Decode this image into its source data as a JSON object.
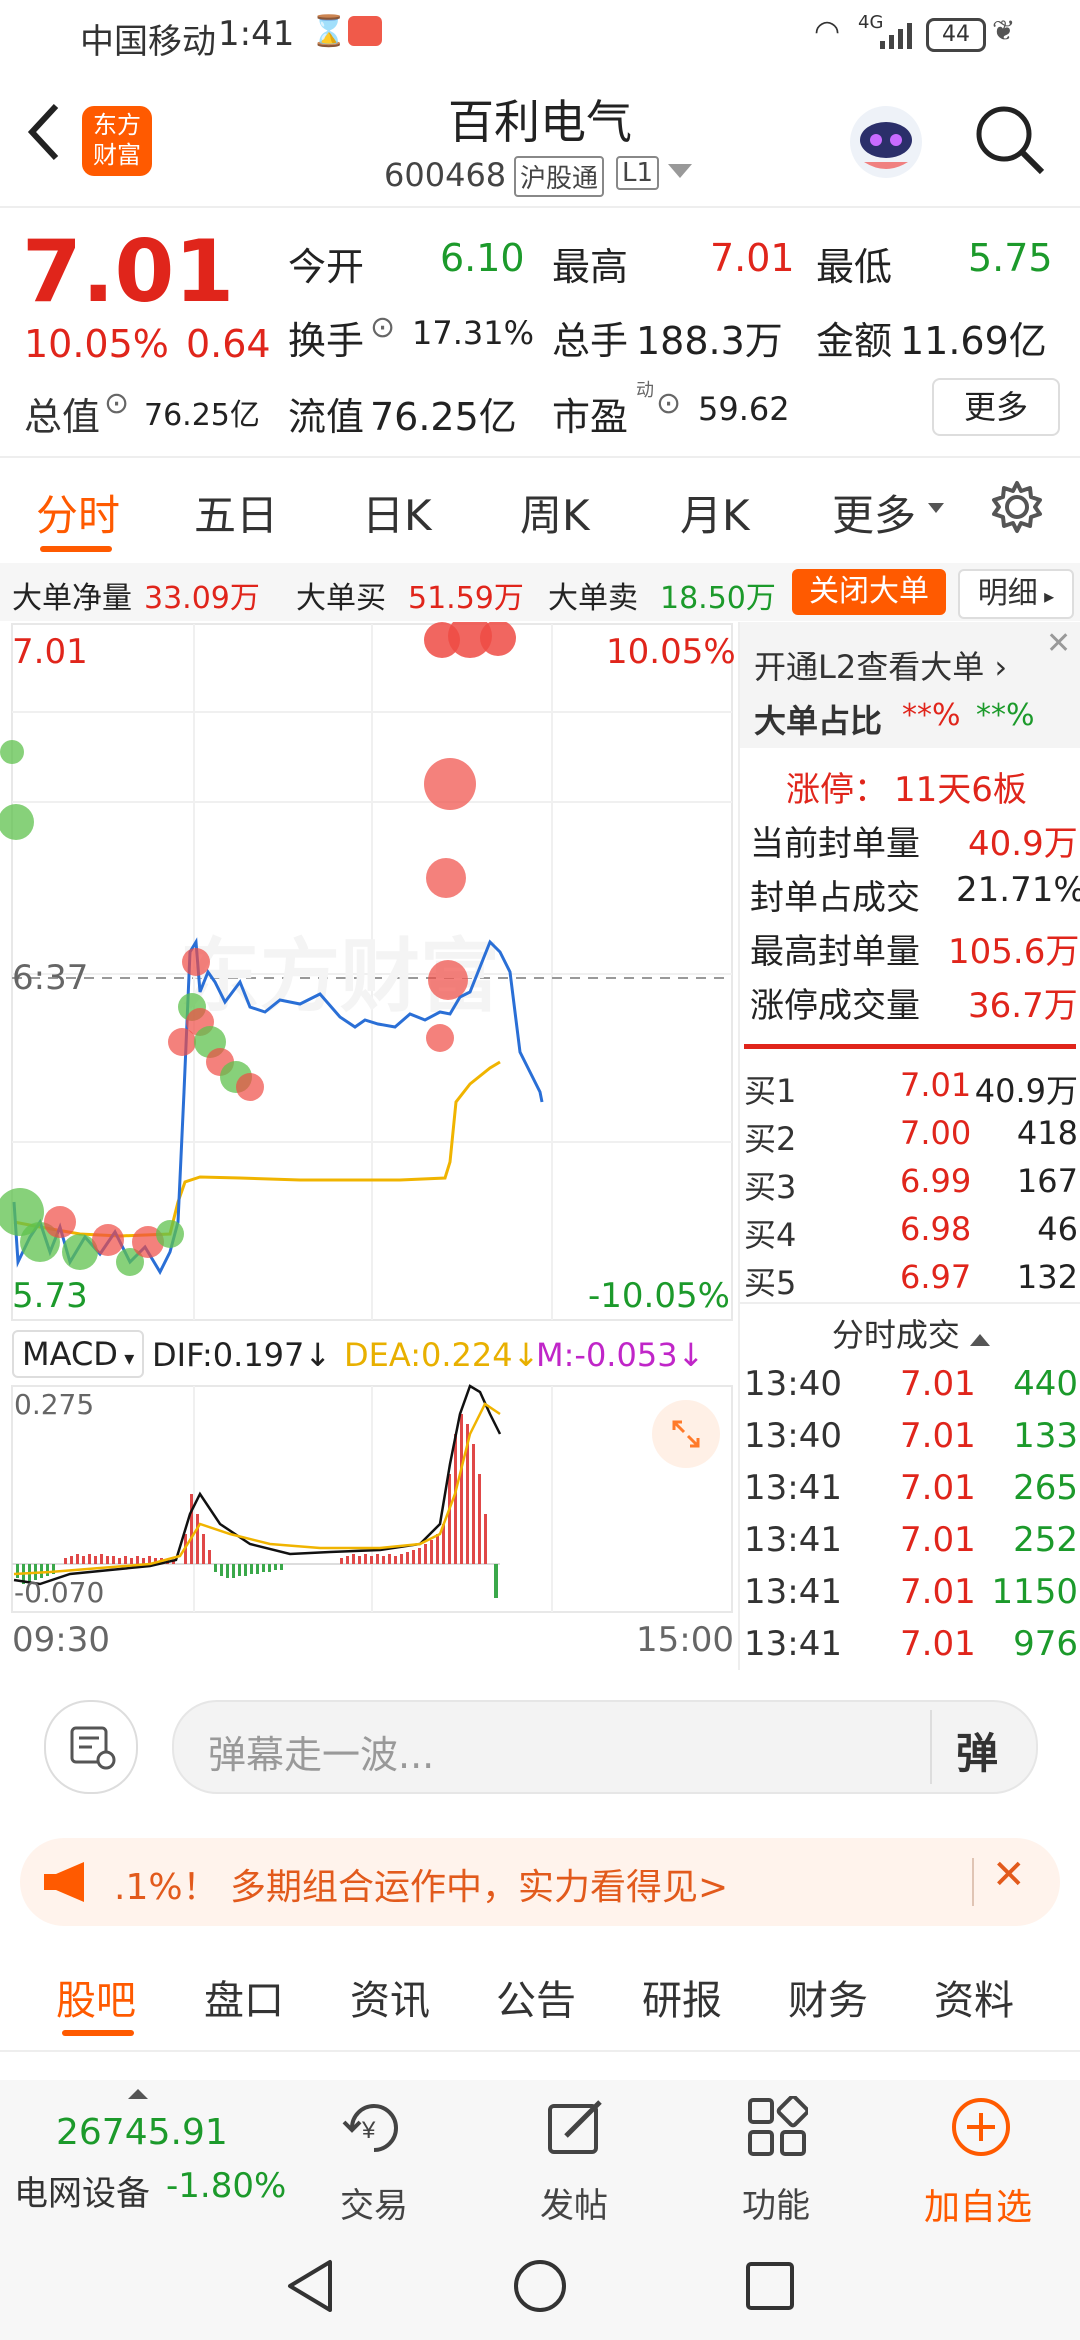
{
  "status_bar": {
    "carrier": "中国移动",
    "time": "1:41",
    "network": "4G",
    "battery": "44"
  },
  "header": {
    "brand_line1": "东方",
    "brand_line2": "财富",
    "stock_name": "百利电气",
    "stock_code": "600468",
    "connect_tag": "沪股通",
    "level_tag": "L1"
  },
  "quote": {
    "price": "7.01",
    "change_pct": "10.05%",
    "change_abs": "0.64",
    "open_label": "今开",
    "open_value": "6.10",
    "high_label": "最高",
    "high_value": "7.01",
    "low_label": "最低",
    "low_value": "5.75",
    "turnover_label": "换手",
    "turnover_value": "17.31%",
    "volume_label": "总手",
    "volume_value": "188.3万",
    "amount_label": "金额",
    "amount_value": "11.69亿",
    "mcap_label": "总值",
    "mcap_value": "76.25亿",
    "float_label": "流值",
    "float_value": "76.25亿",
    "pe_label": "市盈",
    "pe_sup": "动",
    "pe_value": "59.62",
    "more_button": "更多"
  },
  "period_tabs": [
    "分时",
    "五日",
    "日K",
    "周K",
    "月K",
    "更多"
  ],
  "big_order": {
    "net_label": "大单净量",
    "net_value": "33.09万",
    "buy_label": "大单买",
    "buy_value": "51.59万",
    "sell_label": "大单卖",
    "sell_value": "18.50万",
    "close_button": "关闭大单",
    "detail_button": "明细"
  },
  "chart_labels": {
    "top_price": "7.01",
    "top_pct": "10.05%",
    "mid_price": "6:37",
    "bottom_price": "5.73",
    "bottom_pct": "-10.05%",
    "time_start": "09:30",
    "time_end": "15:00",
    "watermark": "东方财富"
  },
  "macd": {
    "name": "MACD",
    "dif": "DIF:0.197↓",
    "dea": "DEA:0.224↓",
    "m": "M:-0.053↓",
    "top_value": "0.275",
    "bottom_value": "-0.070"
  },
  "l2_panel": {
    "title": "开通L2查看大单 ›",
    "ratio_label": "大单占比",
    "ratio_red": "**%",
    "ratio_green": "**%",
    "limit_label": "涨停：",
    "limit_value": "11天6板",
    "seal_label": "当前封单量",
    "seal_value": "40.9万",
    "seal_ratio_label": "封单占成交",
    "seal_ratio_value": "21.71%",
    "max_seal_label": "最高封单量",
    "max_seal_value": "105.6万",
    "limit_vol_label": "涨停成交量",
    "limit_vol_value": "36.7万"
  },
  "order_book": [
    {
      "label": "买1",
      "price": "7.01",
      "vol": "40.9万"
    },
    {
      "label": "买2",
      "price": "7.00",
      "vol": "418"
    },
    {
      "label": "买3",
      "price": "6.99",
      "vol": "167"
    },
    {
      "label": "买4",
      "price": "6.98",
      "vol": "46"
    },
    {
      "label": "买5",
      "price": "6.97",
      "vol": "132"
    }
  ],
  "trades_title": "分时成交",
  "trades": [
    {
      "time": "13:40",
      "price": "7.01",
      "vol": "440"
    },
    {
      "time": "13:40",
      "price": "7.01",
      "vol": "133"
    },
    {
      "time": "13:41",
      "price": "7.01",
      "vol": "265"
    },
    {
      "time": "13:41",
      "price": "7.01",
      "vol": "252"
    },
    {
      "time": "13:41",
      "price": "7.01",
      "vol": "1150"
    },
    {
      "time": "13:41",
      "price": "7.01",
      "vol": "976"
    }
  ],
  "comment": {
    "placeholder": "弹幕走一波...",
    "send_label": "弹"
  },
  "banner": {
    "text": ".1%！ 多期组合运作中，实力看得见>"
  },
  "bottom_tabs": [
    "股吧",
    "盘口",
    "资讯",
    "公告",
    "研报",
    "财务",
    "资料"
  ],
  "dock": {
    "index_value": "26745.91",
    "index_name": "电网设备",
    "index_change": "-1.80%",
    "trade": "交易",
    "post": "发帖",
    "functions": "功能",
    "add_watch": "加自选"
  },
  "colors": {
    "up": "#e0251b",
    "down": "#1c9a2b",
    "accent": "#ff5a00",
    "price_line": "#2a6fd6",
    "avg_line": "#f0b400"
  }
}
